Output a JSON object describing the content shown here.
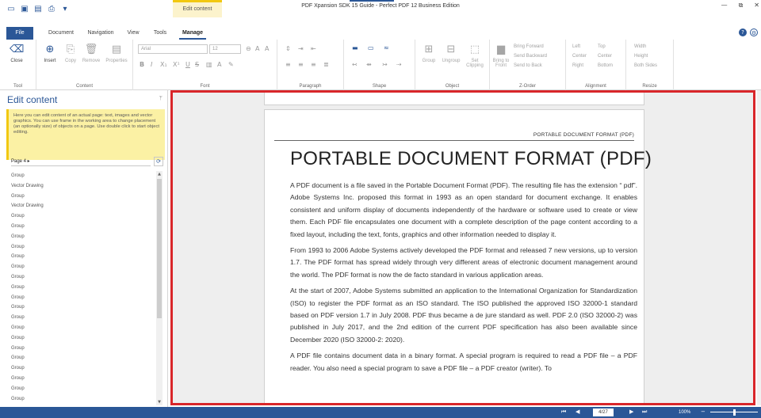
{
  "title_bar": {
    "window_title": "PDF Xpansion SDK 15 Guide - Perfect PDF 12 Business Edition",
    "context_tab_title": "Edit content",
    "quick_access": [
      "folder-icon",
      "save-icon",
      "save-as-icon",
      "print-icon",
      "dropdown-icon"
    ],
    "window_controls": [
      "minimize",
      "restore",
      "close"
    ]
  },
  "ribbon_tabs": {
    "file": "File",
    "document": "Document",
    "navigation": "Navigation",
    "view": "View",
    "tools": "Tools",
    "manage": "Manage",
    "active": "Manage"
  },
  "ribbon": {
    "tool": {
      "close": "Close",
      "label": "Tool"
    },
    "content": {
      "insert": "Insert",
      "copy": "Copy",
      "remove": "Remove",
      "properties": "Properties",
      "label": "Content"
    },
    "font": {
      "font_name": "Arial",
      "font_size": "12",
      "label": "Font"
    },
    "paragraph": {
      "label": "Paragraph"
    },
    "shape": {
      "label": "Shape"
    },
    "object": {
      "group": "Group",
      "ungroup": "Ungroup",
      "set_clipping": "Set Clipping",
      "label": "Object"
    },
    "zorder": {
      "bring_to_front": "Bring to Front",
      "bring_forward": "Bring Forward",
      "send_backward": "Send Backward",
      "send_to_back": "Send to Back",
      "label": "Z-Order"
    },
    "alignment": {
      "left": "Left",
      "top": "Top",
      "center_h": "Center",
      "center_v": "Center",
      "right": "Right",
      "bottom": "Bottom",
      "label": "Alignment"
    },
    "resize": {
      "width": "Width",
      "height": "Height",
      "both_sides": "Both Sides",
      "label": "Resize"
    }
  },
  "panel": {
    "title": "Edit content",
    "hint": "Here you can edit content of an actual page: text, images and vector graphics. You can use frame in the working area to change placement (an optionally size) of objects on a page. Use double click to start object editing.",
    "page_selector": "Page 4 ▸",
    "objects": [
      "Group",
      "Vector Drawing",
      "Group",
      "Vector Drawing",
      "Group",
      "Group",
      "Group",
      "Group",
      "Group",
      "Group",
      "Group",
      "Group",
      "Group",
      "Group",
      "Group",
      "Group",
      "Group",
      "Group",
      "Group",
      "Group",
      "Group",
      "Group",
      "Group"
    ]
  },
  "document": {
    "running_header": "PORTABLE DOCUMENT FORMAT (PDF)",
    "title": "PORTABLE DOCUMENT FORMAT (PDF)",
    "paragraphs": [
      "A PDF document is a file saved in the Portable Document Format (PDF). The resulting file has the extension “ pdf”. Adobe Systems Inc. proposed this format in 1993 as an open standard for document exchange. It enables consistent and uniform display of documents independently of the hardware or software used to create or view them. Each PDF file encapsulates one document with a complete description of the page content according to a fixed layout, including the text, fonts, graphics and other information needed to display it.",
      "From 1993 to 2006 Adobe Systems actively developed the PDF format and released 7 new versions, up to version 1.7. The PDF format has spread widely through very different areas of electronic document management around the world. The PDF format is now the de facto standard in various application areas.",
      "At the start of 2007, Adobe Systems submitted an application to the International Organization for Standardization (ISO) to register the PDF format as an ISO standard. The ISO published the approved ISO 32000-1 standard based on PDF version 1.7 in July 2008. PDF thus became a de jure standard as well. PDF 2.0 (ISO 32000-2) was published in July 2017, and the 2nd edition of the current PDF specification has also been available since December 2020 (ISO 32000-2: 2020).",
      "A PDF file contains document data in a binary format. A special program is required to read a PDF file – a PDF reader. You also need a special program to save a PDF file – a PDF creator (writer). To"
    ]
  },
  "status_bar": {
    "page": "4/27",
    "zoom": "100%",
    "zoom_level_percent": 50
  },
  "colors": {
    "accent": "#2b5797",
    "highlight_border": "#d9262a",
    "hint_background": "#fbf1a4",
    "context_tab": "#f2c811"
  }
}
